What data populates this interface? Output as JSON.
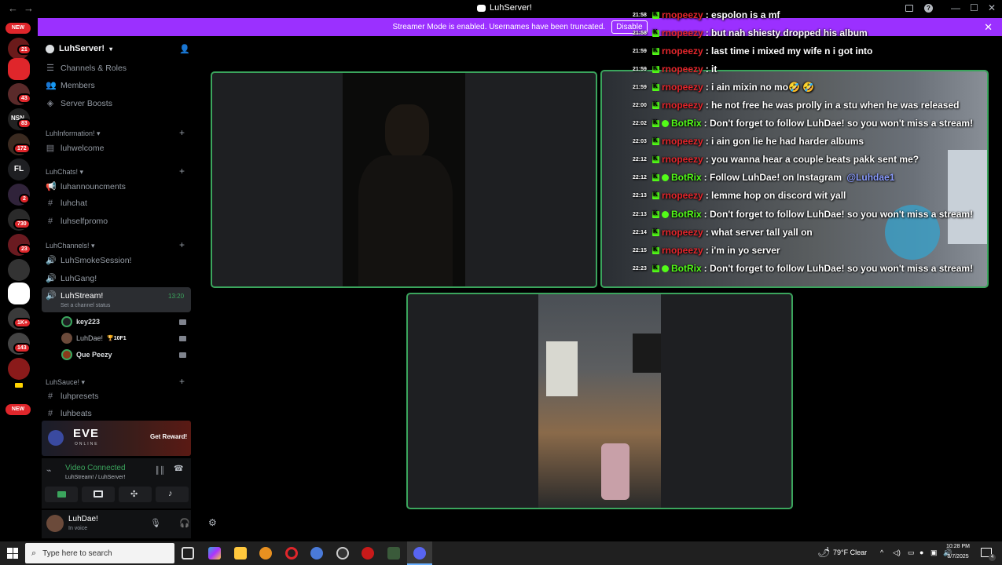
{
  "window": {
    "title": "LuhServer!",
    "nav_back": "←",
    "nav_forward": "→",
    "controls": {
      "minimize": "—",
      "maximize": "☐",
      "close": "✕"
    }
  },
  "banner": {
    "text": "Streamer Mode is enabled. Usernames have been truncated.",
    "disable_label": "Disable",
    "close": "✕"
  },
  "rail": {
    "new_top": "NEW",
    "new_bottom": "NEW",
    "fl_label": "FL",
    "badges": [
      "21",
      "43",
      "83",
      "172",
      "2",
      "730",
      "23",
      "1K+",
      "143"
    ]
  },
  "sidebar": {
    "server_name": "LuhServer!",
    "top_items": [
      "Channels & Roles",
      "Members",
      "Server Boosts"
    ],
    "categories": [
      {
        "name": "LuhInformation!",
        "channels": [
          "luhwelcome"
        ]
      },
      {
        "name": "LuhChats!",
        "channels": [
          "luhannouncments",
          "luhchat",
          "luhselfpromo"
        ]
      },
      {
        "name": "LuhChannels!",
        "channels": [
          "LuhSmokeSession!",
          "LuhGang!"
        ]
      },
      {
        "name": "LuhSauce!",
        "channels": [
          "luhpresets",
          "luhbeats"
        ]
      }
    ],
    "active_channel": {
      "name": "LuhStream!",
      "time": "13:20",
      "status": "Set a channel status"
    },
    "voice_users": [
      {
        "name": "key223"
      },
      {
        "name": "LuhDae!",
        "tag": "10F1"
      },
      {
        "name": "Que Peezy"
      }
    ],
    "promo": {
      "brand": "EVE",
      "sub": "ONLINE",
      "cta": "Get Reward!"
    },
    "voice_connection": {
      "status": "Video Connected",
      "channel": "LuhStream! / LuhServer!"
    },
    "user_panel": {
      "name": "LuhDae!",
      "status": "In voice"
    }
  },
  "chat": [
    {
      "ts": "21:58",
      "user": "rnopeezy",
      "user_color": "red",
      "text": ": espolon is a mf"
    },
    {
      "ts": "21:58",
      "user": "rnopeezy",
      "user_color": "red",
      "text": ": but nah shiesty dropped his album"
    },
    {
      "ts": "21:59",
      "user": "rnopeezy",
      "user_color": "red",
      "text": ": last time i mixed my wife n i got into"
    },
    {
      "ts": "21:59",
      "user": "rnopeezy",
      "user_color": "red",
      "text": ": it"
    },
    {
      "ts": "21:59",
      "user": "rnopeezy",
      "user_color": "red",
      "text": ": i ain mixin no mo🤣 🤣"
    },
    {
      "ts": "22:00",
      "user": "rnopeezy",
      "user_color": "red",
      "text": ": he not free he was prolly in a stu when he was released"
    },
    {
      "ts": "22:02",
      "user": "BotRix",
      "user_color": "green",
      "verified": true,
      "text": ": Don't forget to follow LuhDae! so you won't miss a stream!"
    },
    {
      "ts": "22:03",
      "user": "rnopeezy",
      "user_color": "red",
      "text": ": i ain gon lie he had harder albums"
    },
    {
      "ts": "22:12",
      "user": "rnopeezy",
      "user_color": "red",
      "text": ": you wanna hear a couple beats pakk sent me?"
    },
    {
      "ts": "22:12",
      "user": "BotRix",
      "user_color": "green",
      "verified": true,
      "text": ": Follow LuhDae! on Instagram ",
      "mention": "@Luhdae1"
    },
    {
      "ts": "22:13",
      "user": "rnopeezy",
      "user_color": "red",
      "text": ": lemme hop on discord wit yall"
    },
    {
      "ts": "22:13",
      "user": "BotRix",
      "user_color": "green",
      "verified": true,
      "text": ": Don't forget to follow LuhDae! so you won't miss a stream!"
    },
    {
      "ts": "22:14",
      "user": "rnopeezy",
      "user_color": "red",
      "text": ": what server tall yall on"
    },
    {
      "ts": "22:15",
      "user": "rnopeezy",
      "user_color": "red",
      "text": ": i'm in yo server"
    },
    {
      "ts": "22:23",
      "user": "BotRix",
      "user_color": "green",
      "verified": true,
      "text": ": Don't forget to follow LuhDae! so you won't miss a stream!"
    }
  ],
  "taskbar": {
    "search_placeholder": "Type here to search",
    "weather": "79°F  Clear",
    "time": "10:28 PM",
    "date": "8/7/2025",
    "notif": "4"
  },
  "colors": {
    "accent_green": "#3ba55d",
    "banner_purple": "#9b30ff",
    "kick_green": "#53fc18",
    "alert_red": "#e0262b"
  }
}
